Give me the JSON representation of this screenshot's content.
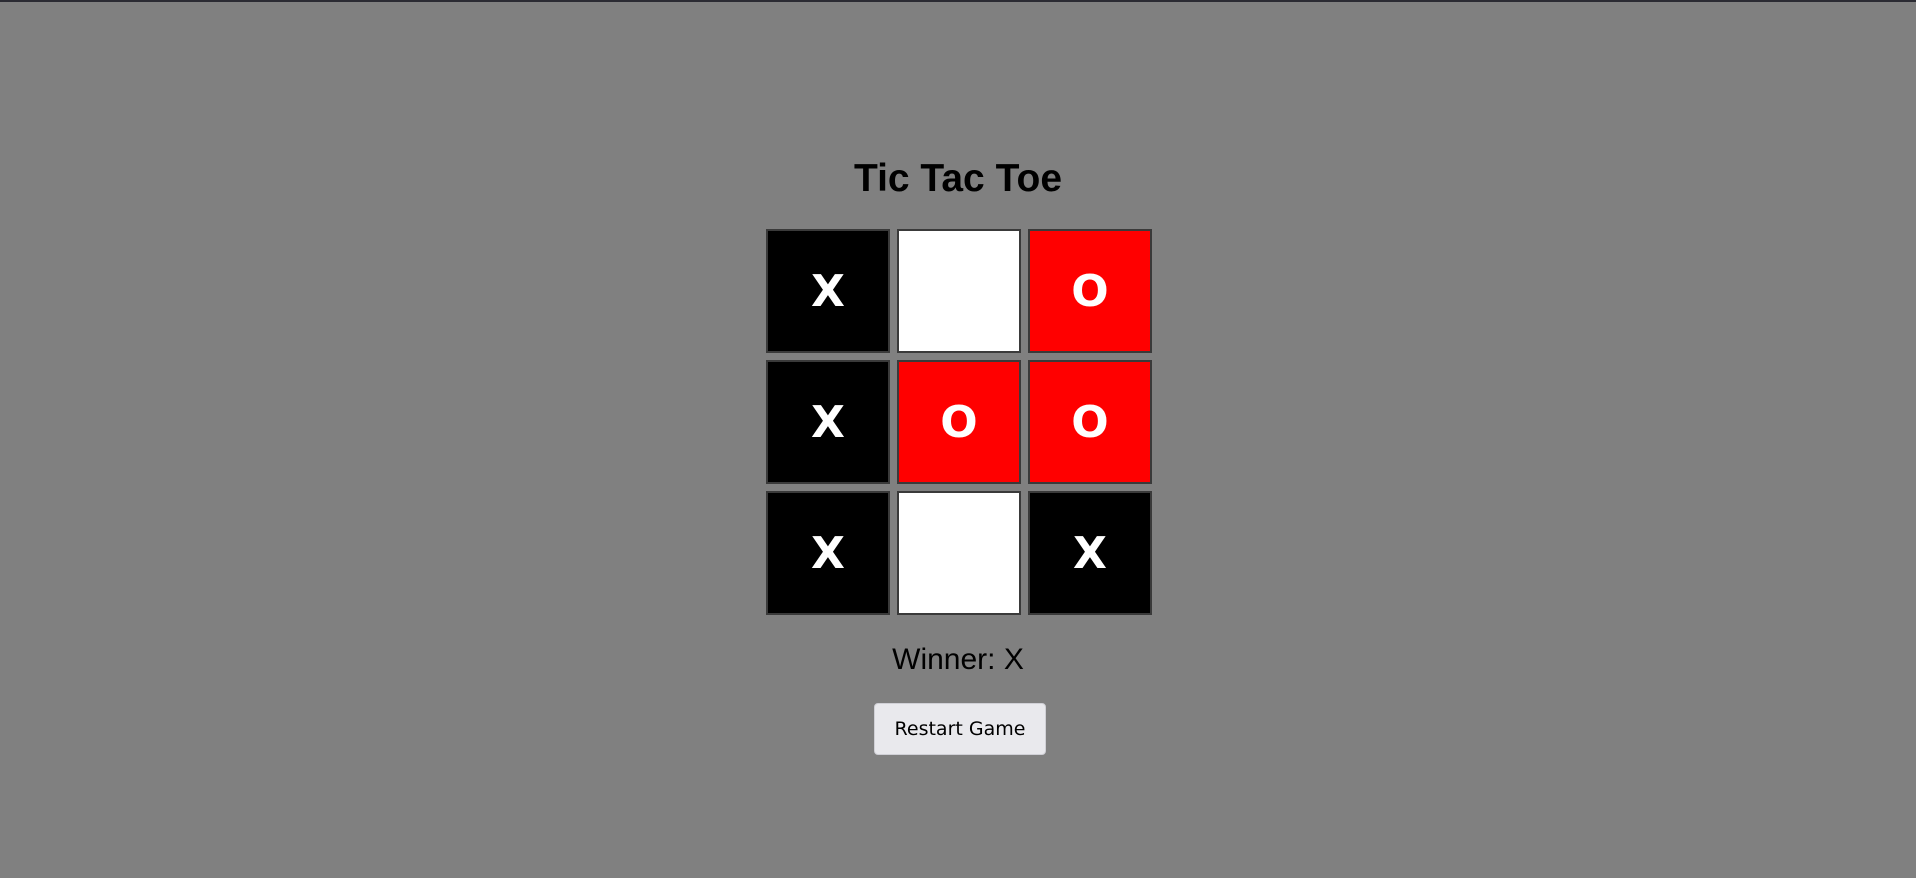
{
  "game": {
    "title": "Tic Tac Toe",
    "board": [
      {
        "mark": "X",
        "color": "#000000"
      },
      {
        "mark": "",
        "color": "#ffffff"
      },
      {
        "mark": "O",
        "color": "#ff0000"
      },
      {
        "mark": "X",
        "color": "#000000"
      },
      {
        "mark": "O",
        "color": "#ff0000"
      },
      {
        "mark": "O",
        "color": "#ff0000"
      },
      {
        "mark": "X",
        "color": "#000000"
      },
      {
        "mark": "",
        "color": "#ffffff"
      },
      {
        "mark": "X",
        "color": "#000000"
      }
    ],
    "status_text": "Winner: X",
    "restart_label": "Restart Game"
  },
  "colors": {
    "background": "#808080",
    "x_cell": "#000000",
    "o_cell": "#ff0000",
    "empty_cell": "#ffffff",
    "mark_text": "#ffffff"
  }
}
